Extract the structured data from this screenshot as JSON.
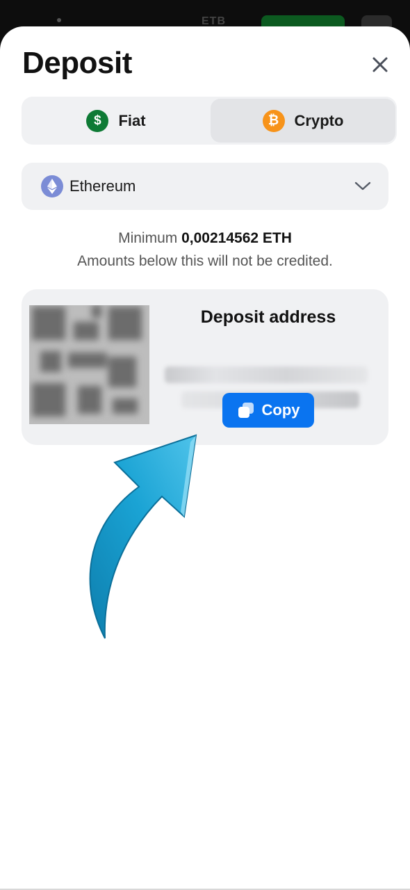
{
  "background_header": {
    "asset_label": "ETB",
    "accent_color": "#0c5a20"
  },
  "sheet": {
    "title": "Deposit",
    "close_icon": "close-icon"
  },
  "tabs": [
    {
      "label": "Fiat",
      "icon": "dollar-coin-icon",
      "icon_text": "$",
      "color": "#0e7a35",
      "selected": false
    },
    {
      "label": "Crypto",
      "icon": "bitcoin-coin-icon",
      "icon_text": "₿",
      "color": "#f7931a",
      "selected": true
    }
  ],
  "network_select": {
    "selected": "Ethereum",
    "icon": "ethereum-icon",
    "chevron": "chevron-down-icon"
  },
  "minimum": {
    "prefix": "Minimum",
    "amount": "0,00214562 ETH",
    "notice": "Amounts below this will not be credited."
  },
  "deposit_card": {
    "title": "Deposit address",
    "qr_code": "qr-code (blurred)",
    "address": "",
    "copy_button": {
      "label": "Copy",
      "icon": "copy-icon",
      "color": "#0a74f0"
    }
  },
  "annotation": {
    "icon": "pointer-arrow-icon",
    "color": "#1a9fd0"
  }
}
